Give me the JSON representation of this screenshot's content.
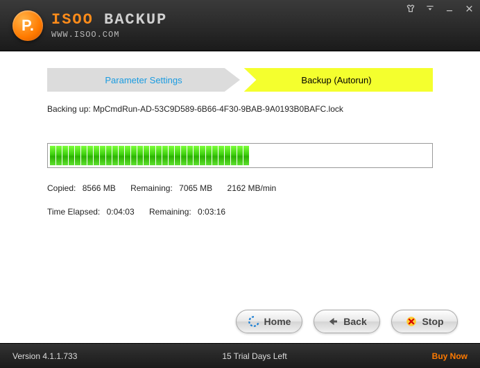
{
  "app": {
    "brand_isoo": "ISOO",
    "brand_backup": "BACKUP",
    "url": "WWW.ISOO.COM",
    "logo_letter": "P."
  },
  "tabs": {
    "param": "Parameter Settings",
    "backup": "Backup (Autorun)"
  },
  "status": {
    "backing_label": "Backing up:",
    "backing_file": "MpCmdRun-AD-53C9D589-6B66-4F30-9BAB-9A0193B0BAFC.lock"
  },
  "progress": {
    "percent": 55
  },
  "stats": {
    "copied_label": "Copied:",
    "copied_value": "8566 MB",
    "remaining_label": "Remaining:",
    "remaining_value": "7065 MB",
    "rate": "2162 MB/min",
    "elapsed_label": "Time Elapsed:",
    "elapsed_value": "0:04:03",
    "time_remaining_label": "Remaining:",
    "time_remaining_value": "0:03:16"
  },
  "buttons": {
    "home": "Home",
    "back": "Back",
    "stop": "Stop"
  },
  "footer": {
    "version": "Version 4.1.1.733",
    "trial": "15 Trial Days Left",
    "buy": "Buy Now"
  },
  "colors": {
    "accent": "#ff8c1a",
    "active_tab": "#f4ff2e",
    "progress": "#3ecf0f"
  }
}
